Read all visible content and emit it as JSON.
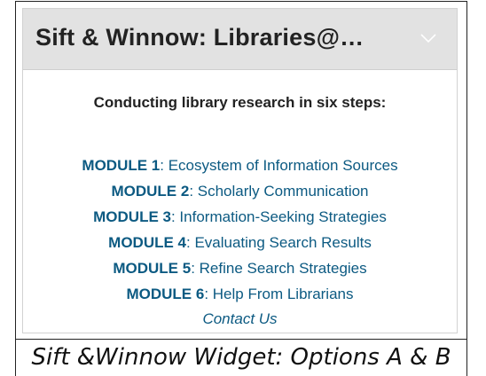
{
  "widget": {
    "title": "Sift & Winnow: Libraries@…",
    "expand_icon": "chevron-down-icon",
    "intro": "Conducting library research in six steps:",
    "modules": [
      {
        "number": "MODULE 1",
        "title": ": Ecosystem of Information Sources"
      },
      {
        "number": "MODULE 2",
        "title": ": Scholarly Communication"
      },
      {
        "number": "MODULE 3",
        "title": ": Information-Seeking Strategies"
      },
      {
        "number": "MODULE 4",
        "title": ": Evaluating Search Results"
      },
      {
        "number": "MODULE 5",
        "title": ": Refine Search Strategies"
      },
      {
        "number": "MODULE 6",
        "title": ": Help From Librarians"
      }
    ],
    "contact_label": "Contact Us"
  },
  "caption": "Sift &Winnow Widget: Options A & B",
  "colors": {
    "header_bg": "#e2e2e2",
    "link": "#0c5a82",
    "text": "#222222"
  }
}
